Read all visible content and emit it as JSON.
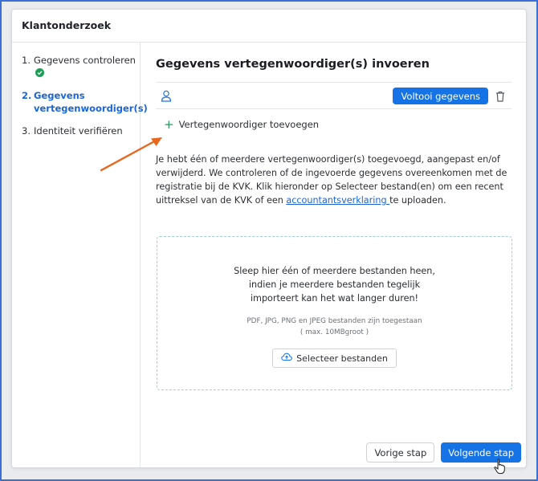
{
  "header": {
    "title": "Klantonderzoek"
  },
  "sidebar": {
    "steps": [
      {
        "num": "1.",
        "label": "Gegevens controleren",
        "status": "done"
      },
      {
        "num": "2.",
        "label": "Gegevens vertegenwoordiger(s)",
        "status": "active"
      },
      {
        "num": "3.",
        "label": "Identiteit verifiëren",
        "status": "todo"
      }
    ]
  },
  "main": {
    "title": "Gegevens vertegenwoordiger(s) invoeren",
    "representative": {
      "complete_button": "Voltooi gegevens"
    },
    "add_representative": "Vertegenwoordiger toevoegen",
    "info": {
      "text": "Je hebt één of meerdere vertegenwoordiger(s) toegevoegd, aangepast en/of verwijderd. We controleren of de ingevoerde gegevens overeenkomen met de registratie bij de KVK. Klik hieronder op Selecteer bestand(en) om een recent uittreksel van de KVK of een ",
      "link": "accountantsverklaring ",
      "after": "te uploaden."
    },
    "dropzone": {
      "line1": "Sleep hier één of meerdere bestanden heen,",
      "line2": "indien je meerdere bestanden tegelijk",
      "line3": "importeert kan het wat langer duren!",
      "formats": "PDF, JPG, PNG en JPEG bestanden zijn toegestaan",
      "max": "( max. 10MBgroot )",
      "select_button": "Selecteer bestanden"
    }
  },
  "footer": {
    "prev_button": "Vorige stap",
    "next_button": "Volgende stap"
  },
  "colors": {
    "primary": "#1673e6",
    "success": "#1f9d57",
    "annotation_arrow": "#e8671f",
    "dropzone_border": "#9ecfda"
  }
}
